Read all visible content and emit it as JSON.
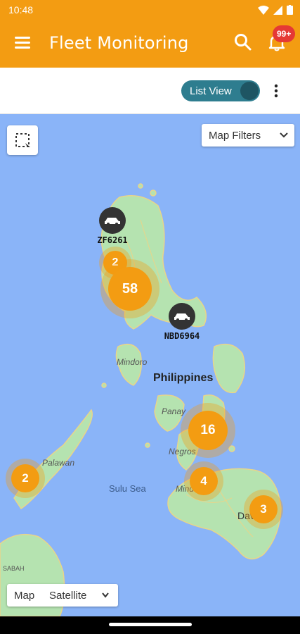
{
  "status_bar": {
    "time": "10:48"
  },
  "app_bar": {
    "title": "Fleet Monitoring",
    "notification_count": "99+"
  },
  "toolbar": {
    "toggle_label": "List View"
  },
  "map": {
    "filters_label": "Map Filters",
    "map_type_map": "Map",
    "map_type_satellite": "Satellite",
    "country_label": "Philippines",
    "sea_label": "Sulu Sea",
    "place_labels": [
      "Mindoro",
      "Panay",
      "Negros",
      "Palawan",
      "Mind",
      "Dav",
      "SABAH"
    ],
    "clusters": [
      {
        "count": "2"
      },
      {
        "count": "58"
      },
      {
        "count": "16"
      },
      {
        "count": "4"
      },
      {
        "count": "3"
      },
      {
        "count": "2"
      }
    ],
    "vehicles": [
      {
        "plate": "ZF6261"
      },
      {
        "plate": "NBD6964"
      }
    ]
  },
  "colors": {
    "brand": "#F39C12",
    "toggle": "#2E7D8F",
    "badge": "#E53935",
    "water": "#8AB4F8",
    "land": "#B5E3B0"
  }
}
